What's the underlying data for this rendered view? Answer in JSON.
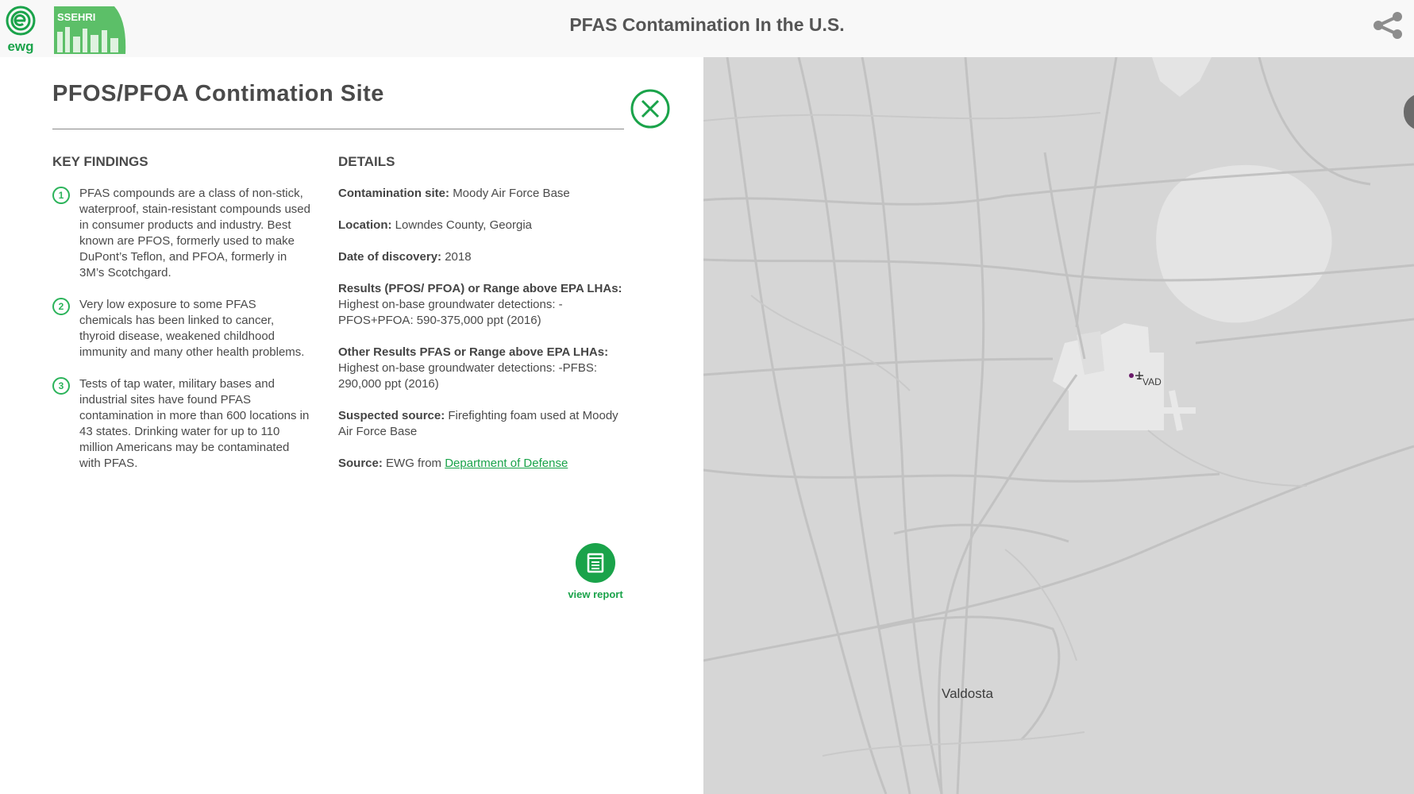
{
  "header": {
    "title": "PFAS Contamination In the U.S.",
    "logos": {
      "ewg_text": "ewg",
      "ssehri_text": "SSEHRI"
    },
    "share_icon": "share-icon"
  },
  "panel": {
    "title": "PFOS/PFOA Contimation Site",
    "close_icon": "close-icon",
    "key_findings": {
      "heading": "KEY FINDINGS",
      "items": [
        {
          "num": "1",
          "text": "PFAS compounds are a class of non-stick, waterproof, stain-resistant compounds used in consumer products and industry. Best known are PFOS, formerly used to make DuPont’s Teflon, and PFOA, formerly in 3M’s Scotchgard."
        },
        {
          "num": "2",
          "text": "Very low exposure to some PFAS chemicals has been linked to cancer, thyroid disease, weakened childhood immunity and many other health problems."
        },
        {
          "num": "3",
          "text": "Tests of tap water, military bases and industrial sites have found PFAS contamination in more than 600 locations in 43 states. Drinking water for up to 110 million Americans may be contaminated with PFAS."
        }
      ]
    },
    "details": {
      "heading": "DETAILS",
      "contamination_site": {
        "label": "Contamination site:",
        "value": "Moody Air Force Base"
      },
      "location": {
        "label": "Location:",
        "value": "Lowndes County, Georgia"
      },
      "date": {
        "label": "Date of discovery:",
        "value": "2018"
      },
      "results": {
        "label": "Results (PFOS/ PFOA) or Range above EPA LHAs:",
        "value": "Highest on-base groundwater detections: -PFOS+PFOA: 590-375,000 ppt (2016)"
      },
      "other_results": {
        "label": "Other Results PFAS or Range above EPA LHAs:",
        "value": "Highest on-base groundwater detections: -PFBS: 290,000 ppt (2016)"
      },
      "suspected_source": {
        "label": "Suspected source:",
        "value": "Firefighting foam used at Moody Air Force Base"
      },
      "source": {
        "label": "Source:",
        "value": "EWG from",
        "link": "Department of Defense"
      }
    },
    "view_report": {
      "label": "view report",
      "icon": "document-icon"
    }
  },
  "map": {
    "city": "Valdosta",
    "airport": "VAD",
    "airport_icon": "airplane-icon"
  },
  "colors": {
    "brand_green": "#1aa34a",
    "map_bg": "#d6d6d6",
    "road": "#bcbcbc",
    "water": "#e4e4e4"
  }
}
